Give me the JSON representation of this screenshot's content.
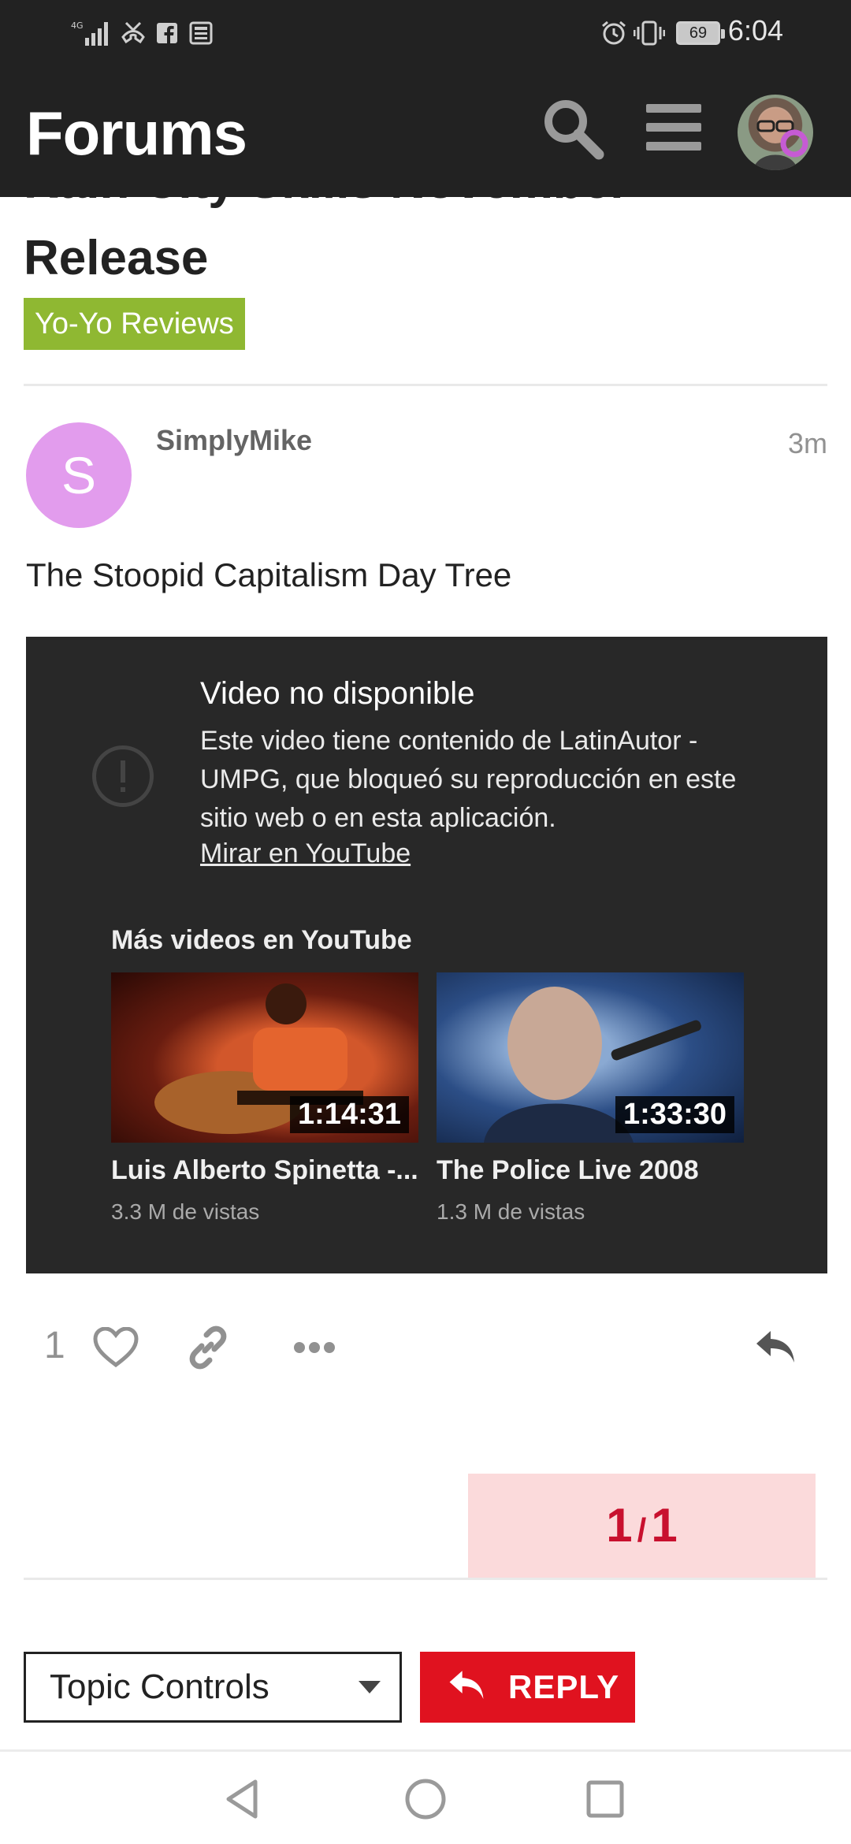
{
  "status_bar": {
    "time": "6:04",
    "battery": "69",
    "icons": [
      "signal-4g-icon",
      "missed-call-icon",
      "facebook-icon",
      "news-icon",
      "alarm-icon",
      "vibrate-icon",
      "battery-icon"
    ]
  },
  "header": {
    "title": "Forums",
    "icons": [
      "search-icon",
      "hamburger-menu-icon",
      "user-avatar"
    ]
  },
  "topic": {
    "title_cut": "Rain City Skills November",
    "title": "Release",
    "category": "Yo-Yo Reviews",
    "category_color": "#8fb832"
  },
  "post": {
    "avatar_letter": "S",
    "avatar_color": "#e29ced",
    "username": "SimplyMike",
    "time": "3m",
    "text": "The Stoopid Capitalism Day Tree",
    "like_count": "1"
  },
  "video": {
    "title": "Video no disponible",
    "description": "Este video tiene contenido de LatinAutor - UMPG, que bloqueó su reproducción en este sitio web o en esta aplicación.",
    "link": "Mirar en YouTube",
    "more_label": "Más videos en YouTube",
    "suggestions": [
      {
        "title": "Luis Alberto Spinetta -...",
        "views": "3.3 M de vistas",
        "duration": "1:14:31"
      },
      {
        "title": "The Police Live 2008",
        "views": "1.3 M de vistas",
        "duration": "1:33:30"
      }
    ]
  },
  "progress": {
    "current": "1",
    "total": "1"
  },
  "controls": {
    "topic_controls_label": "Topic Controls",
    "reply_label": "REPLY"
  },
  "colors": {
    "header_bg": "#222222",
    "reply_red": "#e0121f",
    "progress_bg": "#fbdadb"
  }
}
